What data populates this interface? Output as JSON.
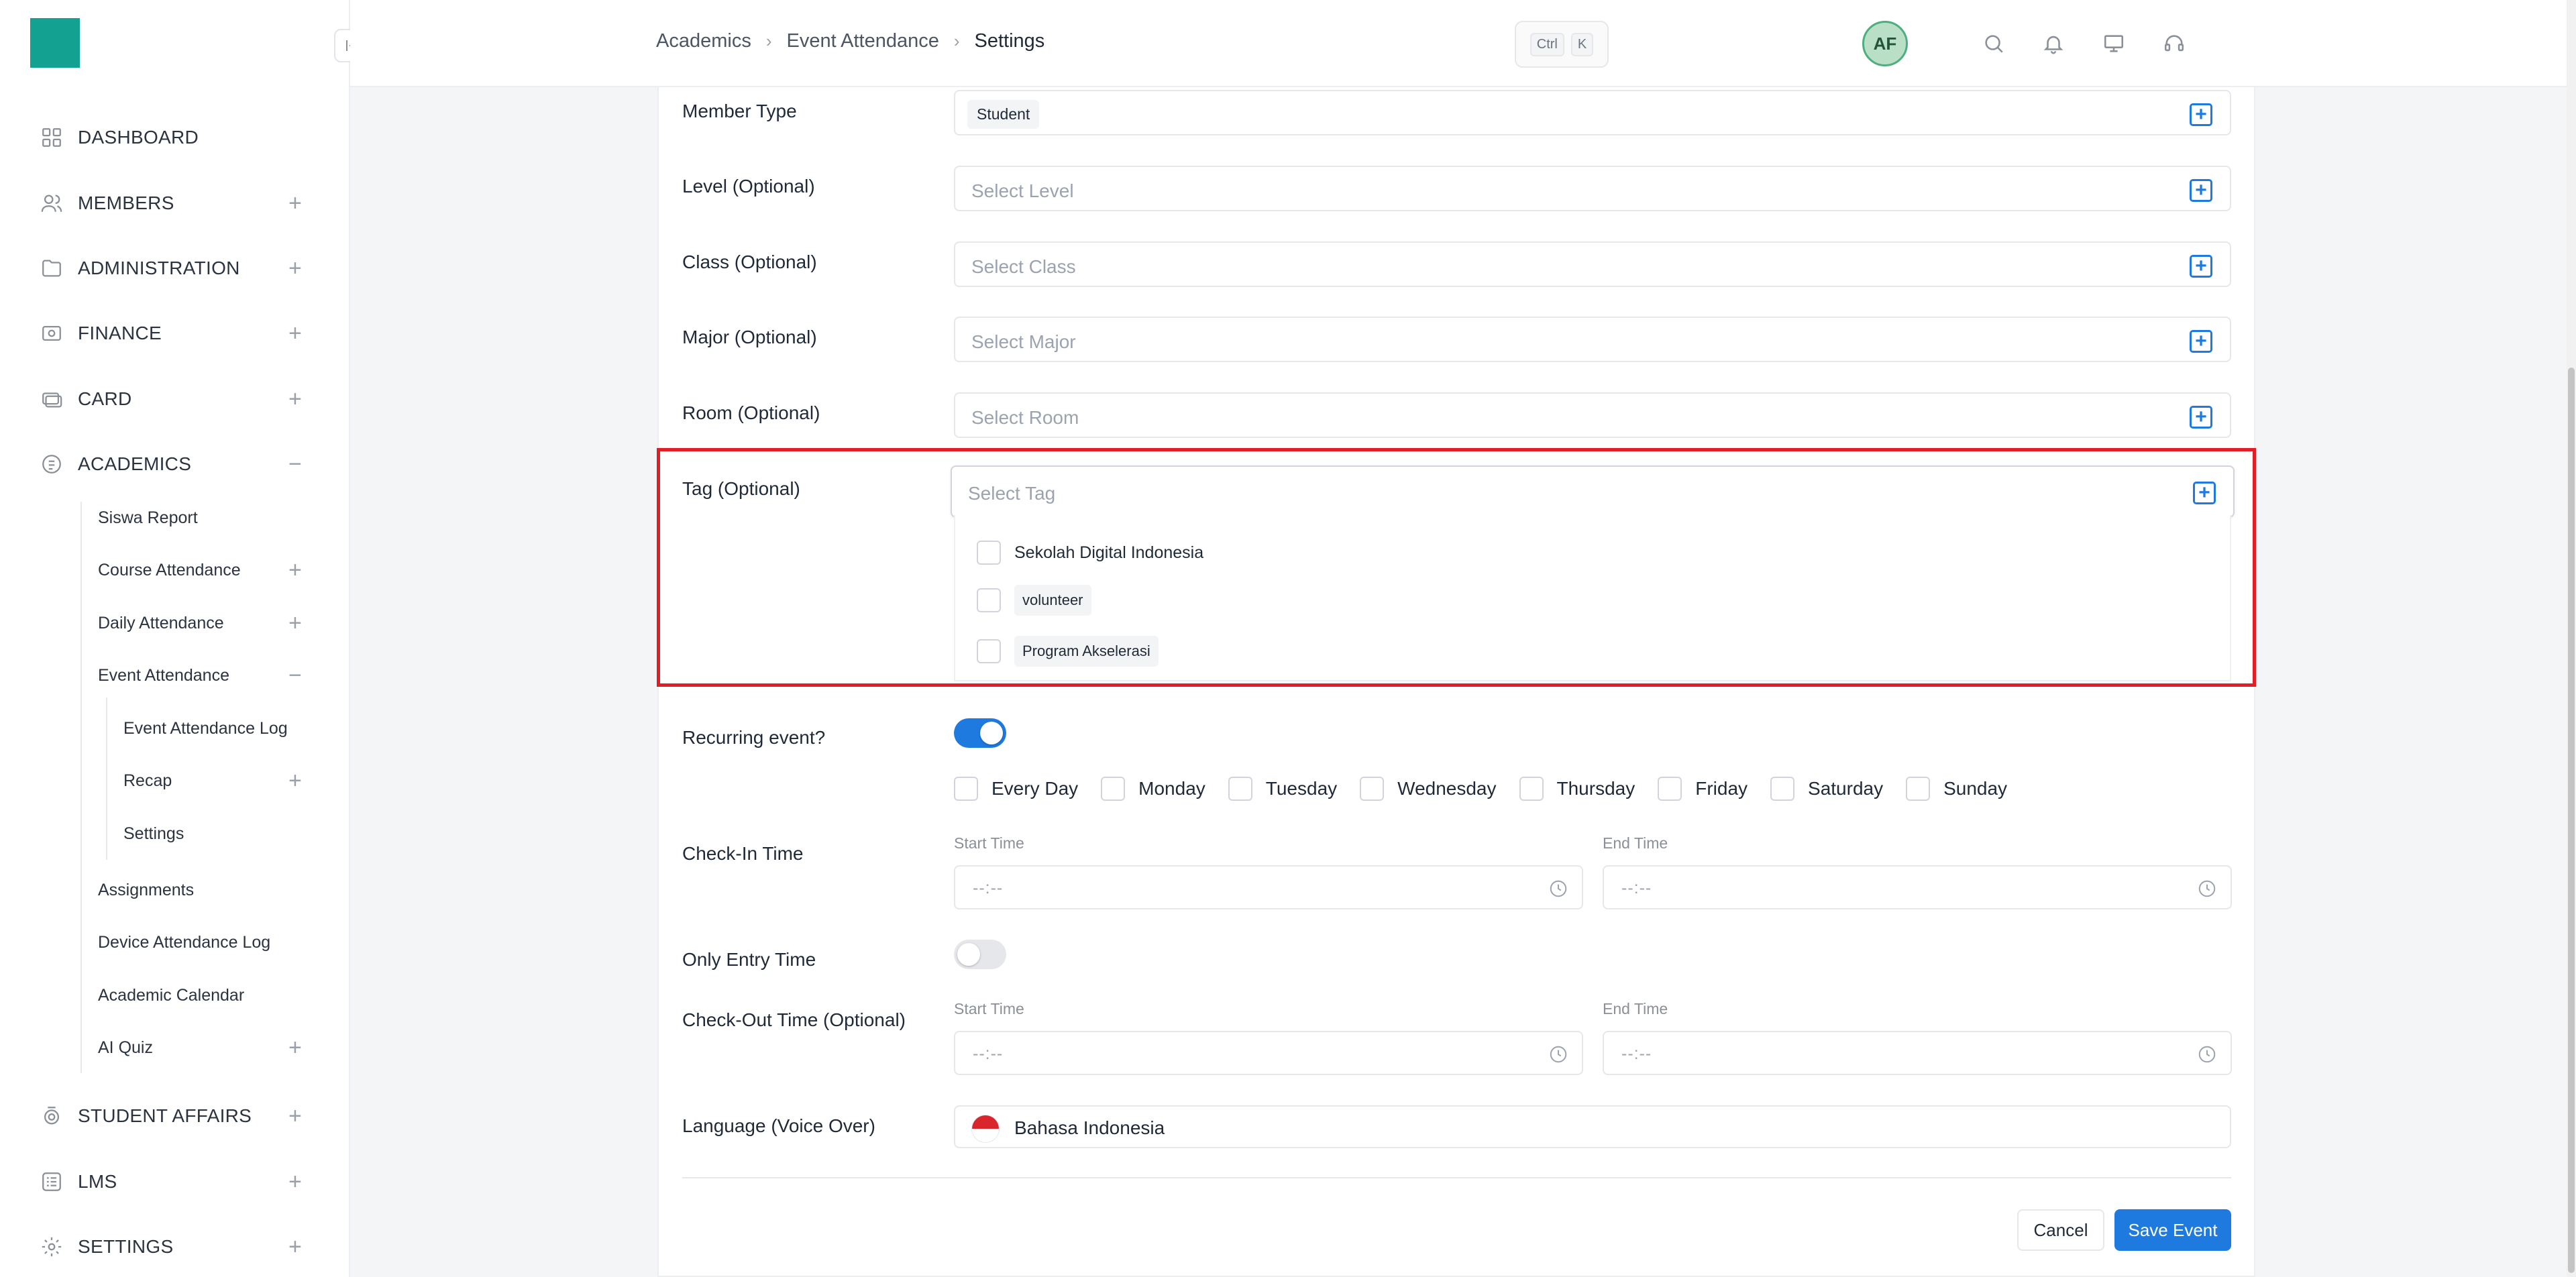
{
  "sidebar": {
    "items": [
      {
        "label": "DASHBOARD",
        "icon": "dashboard-icon",
        "expander": ""
      },
      {
        "label": "MEMBERS",
        "icon": "members-icon",
        "expander": "+"
      },
      {
        "label": "ADMINISTRATION",
        "icon": "folder-icon",
        "expander": "+"
      },
      {
        "label": "FINANCE",
        "icon": "finance-icon",
        "expander": "+"
      },
      {
        "label": "CARD",
        "icon": "card-icon",
        "expander": "+"
      },
      {
        "label": "ACADEMICS",
        "icon": "academics-icon",
        "expander": "−"
      },
      {
        "label": "STUDENT AFFAIRS",
        "icon": "student-affairs-icon",
        "expander": "+"
      },
      {
        "label": "LMS",
        "icon": "lms-icon",
        "expander": "+"
      },
      {
        "label": "SETTINGS",
        "icon": "gear-icon",
        "expander": "+"
      }
    ],
    "academics_sub": [
      {
        "label": "Siswa Report",
        "expander": ""
      },
      {
        "label": "Course Attendance",
        "expander": "+"
      },
      {
        "label": "Daily Attendance",
        "expander": "+"
      },
      {
        "label": "Event Attendance",
        "expander": "−"
      },
      {
        "label": "Assignments",
        "expander": ""
      },
      {
        "label": "Device Attendance Log",
        "expander": ""
      },
      {
        "label": "Academic Calendar",
        "expander": ""
      },
      {
        "label": "AI Quiz",
        "expander": "+"
      }
    ],
    "event_attendance_sub": [
      {
        "label": "Event Attendance Log",
        "expander": ""
      },
      {
        "label": "Recap",
        "expander": "+"
      },
      {
        "label": "Settings",
        "expander": ""
      }
    ]
  },
  "header": {
    "breadcrumb": [
      "Academics",
      "Event Attendance",
      "Settings"
    ],
    "shortcut": [
      "Ctrl",
      "K"
    ],
    "avatar_initials": "AF"
  },
  "form": {
    "member_type": {
      "label": "Member Type",
      "value": "Student"
    },
    "level": {
      "label": "Level (Optional)",
      "placeholder": "Select Level"
    },
    "class": {
      "label": "Class (Optional)",
      "placeholder": "Select Class"
    },
    "major": {
      "label": "Major (Optional)",
      "placeholder": "Select Major"
    },
    "room": {
      "label": "Room (Optional)",
      "placeholder": "Select Room"
    },
    "tag": {
      "label": "Tag (Optional)",
      "placeholder": "Select Tag",
      "options": [
        "Sekolah Digital Indonesia",
        "volunteer",
        "Program Akselerasi"
      ]
    },
    "recurring": {
      "label": "Recurring event?",
      "enabled": true
    },
    "days": [
      "Every Day",
      "Monday",
      "Tuesday",
      "Wednesday",
      "Thursday",
      "Friday",
      "Saturday",
      "Sunday"
    ],
    "check_in": {
      "label": "Check-In Time",
      "start_label": "Start Time",
      "end_label": "End Time",
      "start_value": "--:--",
      "end_value": "--:--"
    },
    "only_entry": {
      "label": "Only Entry Time",
      "enabled": false
    },
    "check_out": {
      "label": "Check-Out Time (Optional)",
      "start_label": "Start Time",
      "end_label": "End Time",
      "start_value": "--:--",
      "end_value": "--:--"
    },
    "language": {
      "label": "Language (Voice Over)",
      "value": "Bahasa Indonesia"
    },
    "cancel_label": "Cancel",
    "save_label": "Save Event"
  },
  "colors": {
    "accent": "#1f7ae0",
    "logo": "#13a291",
    "highlight": "#e01e25"
  }
}
